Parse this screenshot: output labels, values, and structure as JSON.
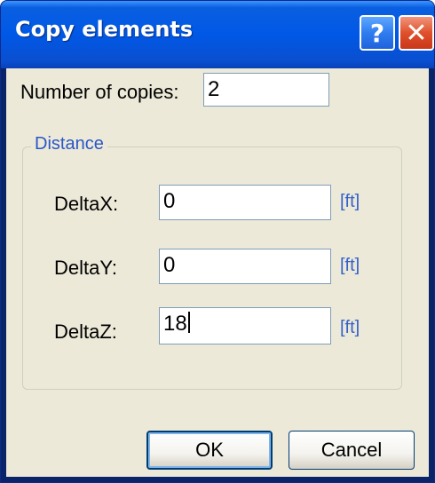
{
  "window": {
    "title": "Copy elements",
    "help_glyph": "?",
    "close_glyph": "✕"
  },
  "number_of_copies": {
    "label": "Number of copies:",
    "value": "2"
  },
  "distance": {
    "group_title": "Distance",
    "fields": [
      {
        "label": "DeltaX:",
        "value": "0",
        "unit": "[ft]"
      },
      {
        "label": "DeltaY:",
        "value": "0",
        "unit": "[ft]"
      },
      {
        "label": "DeltaZ:",
        "value": "18",
        "unit": "[ft]"
      }
    ]
  },
  "buttons": {
    "ok_label": "OK",
    "cancel_label": "Cancel"
  },
  "icons": {
    "help": "help-icon",
    "close": "close-icon"
  },
  "colors": {
    "titlebar": "#0058e6",
    "dialog_background": "#ece9d8",
    "unit_text": "#3561c8",
    "close_button": "#e0502c"
  }
}
